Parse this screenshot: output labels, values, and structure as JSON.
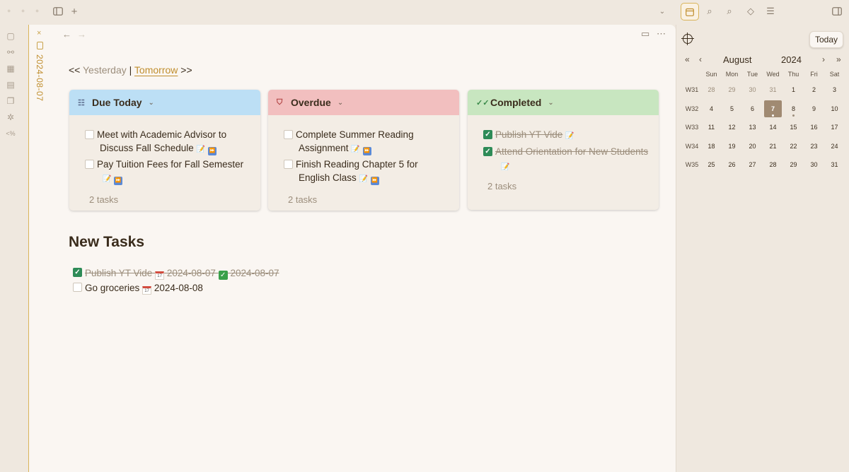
{
  "app": {
    "tab_title": "2024-08-07"
  },
  "nav": {
    "back": "←",
    "forward": "→",
    "more": "⋯"
  },
  "daynav": {
    "prefix": "<<",
    "yesterday": "Yesterday",
    "separator": "|",
    "tomorrow": "Tomorrow",
    "suffix": ">>"
  },
  "cards": [
    {
      "title": "Due Today",
      "color": "#bcdff5",
      "tasks": [
        {
          "line1": "Meet with Academic Advisor to",
          "line2": "Discuss Fall Schedule",
          "done": false
        },
        {
          "line1": "Pay Tuition Fees for Fall Semester",
          "line2": "",
          "done": false
        }
      ],
      "count": "2 tasks"
    },
    {
      "title": "Overdue",
      "color": "#f2bfbf",
      "tasks": [
        {
          "line1": "Complete Summer Reading",
          "line2": "Assignment",
          "done": false
        },
        {
          "line1": "Finish Reading Chapter 5 for",
          "line2": "English Class",
          "done": false
        }
      ],
      "count": "2 tasks"
    },
    {
      "title": "Completed",
      "color": "#c8e6c0",
      "tasks": [
        {
          "line1": "Publish YT Vide",
          "done": true
        },
        {
          "line1": "Attend Orientation for New Students",
          "done": true
        }
      ],
      "count": "2 tasks"
    }
  ],
  "new_tasks": {
    "heading": "New Tasks",
    "items": [
      {
        "text": "Publish YT Vide",
        "due": "2024-08-07",
        "completed_on": "2024-08-07",
        "done": true
      },
      {
        "text": "Go groceries",
        "due": "2024-08-08",
        "done": false
      }
    ]
  },
  "calendar": {
    "today_label": "Today",
    "month": "August",
    "year": "2024",
    "nav": {
      "prev_year": "«",
      "prev_month": "‹",
      "next_month": "›",
      "next_year": "»"
    },
    "weekdays": [
      "Sun",
      "Mon",
      "Tue",
      "Wed",
      "Thu",
      "Fri",
      "Sat"
    ],
    "weeks": [
      {
        "label": "W31",
        "days": [
          "28",
          "29",
          "30",
          "31",
          "1",
          "2",
          "3"
        ]
      },
      {
        "label": "W32",
        "days": [
          "4",
          "5",
          "6",
          "7",
          "8",
          "9",
          "10"
        ]
      },
      {
        "label": "W33",
        "days": [
          "11",
          "12",
          "13",
          "14",
          "15",
          "16",
          "17"
        ]
      },
      {
        "label": "W34",
        "days": [
          "18",
          "19",
          "20",
          "21",
          "22",
          "23",
          "24"
        ]
      },
      {
        "label": "W35",
        "days": [
          "25",
          "26",
          "27",
          "28",
          "29",
          "30",
          "31"
        ]
      }
    ],
    "selected_day": "7"
  }
}
